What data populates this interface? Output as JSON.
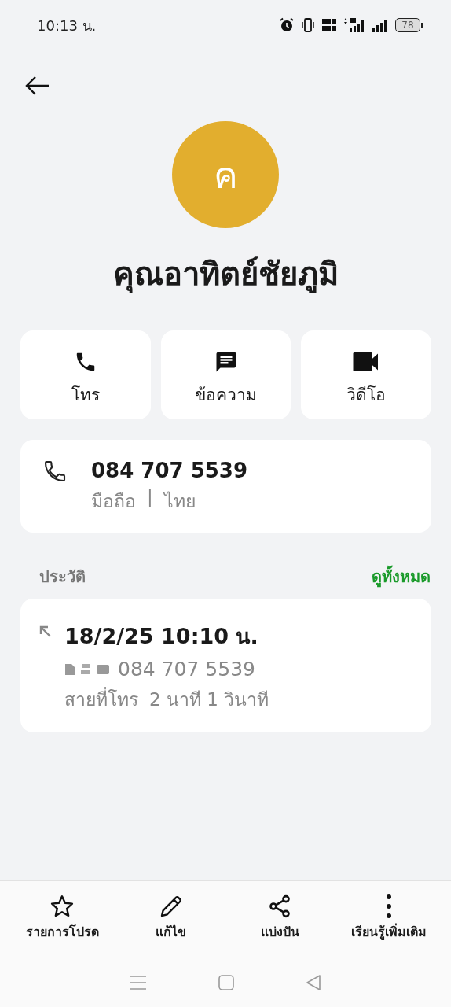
{
  "status_bar": {
    "time": "10:13 น.",
    "battery": "78"
  },
  "contact": {
    "initial": "ค",
    "color": "#e2ae2e",
    "name": "คุณอาทิตย์ชัยภูมิ"
  },
  "actions": [
    {
      "kind": "call",
      "label": "โทร"
    },
    {
      "kind": "message",
      "label": "ข้อความ"
    },
    {
      "kind": "video",
      "label": "วิดีโอ"
    }
  ],
  "phone": {
    "number": "084 707 5539",
    "type": "มือถือ",
    "separator": "|",
    "region": "ไทย"
  },
  "history": {
    "title": "ประวัติ",
    "see_all": "ดูทั้งหมด",
    "entries": [
      {
        "kind": "outgoing",
        "datetime": "18/2/25 10:10 น.",
        "number": "084 707 5539",
        "type": "สายที่โทร",
        "duration": "2 นาที 1 วินาที"
      }
    ]
  },
  "bottom_actions": [
    {
      "kind": "favorite",
      "label": "รายการโปรด"
    },
    {
      "kind": "edit",
      "label": "แก้ไข"
    },
    {
      "kind": "share",
      "label": "แบ่งปัน"
    },
    {
      "kind": "more",
      "label": "เรียนรู้เพิ่มเติม"
    }
  ]
}
